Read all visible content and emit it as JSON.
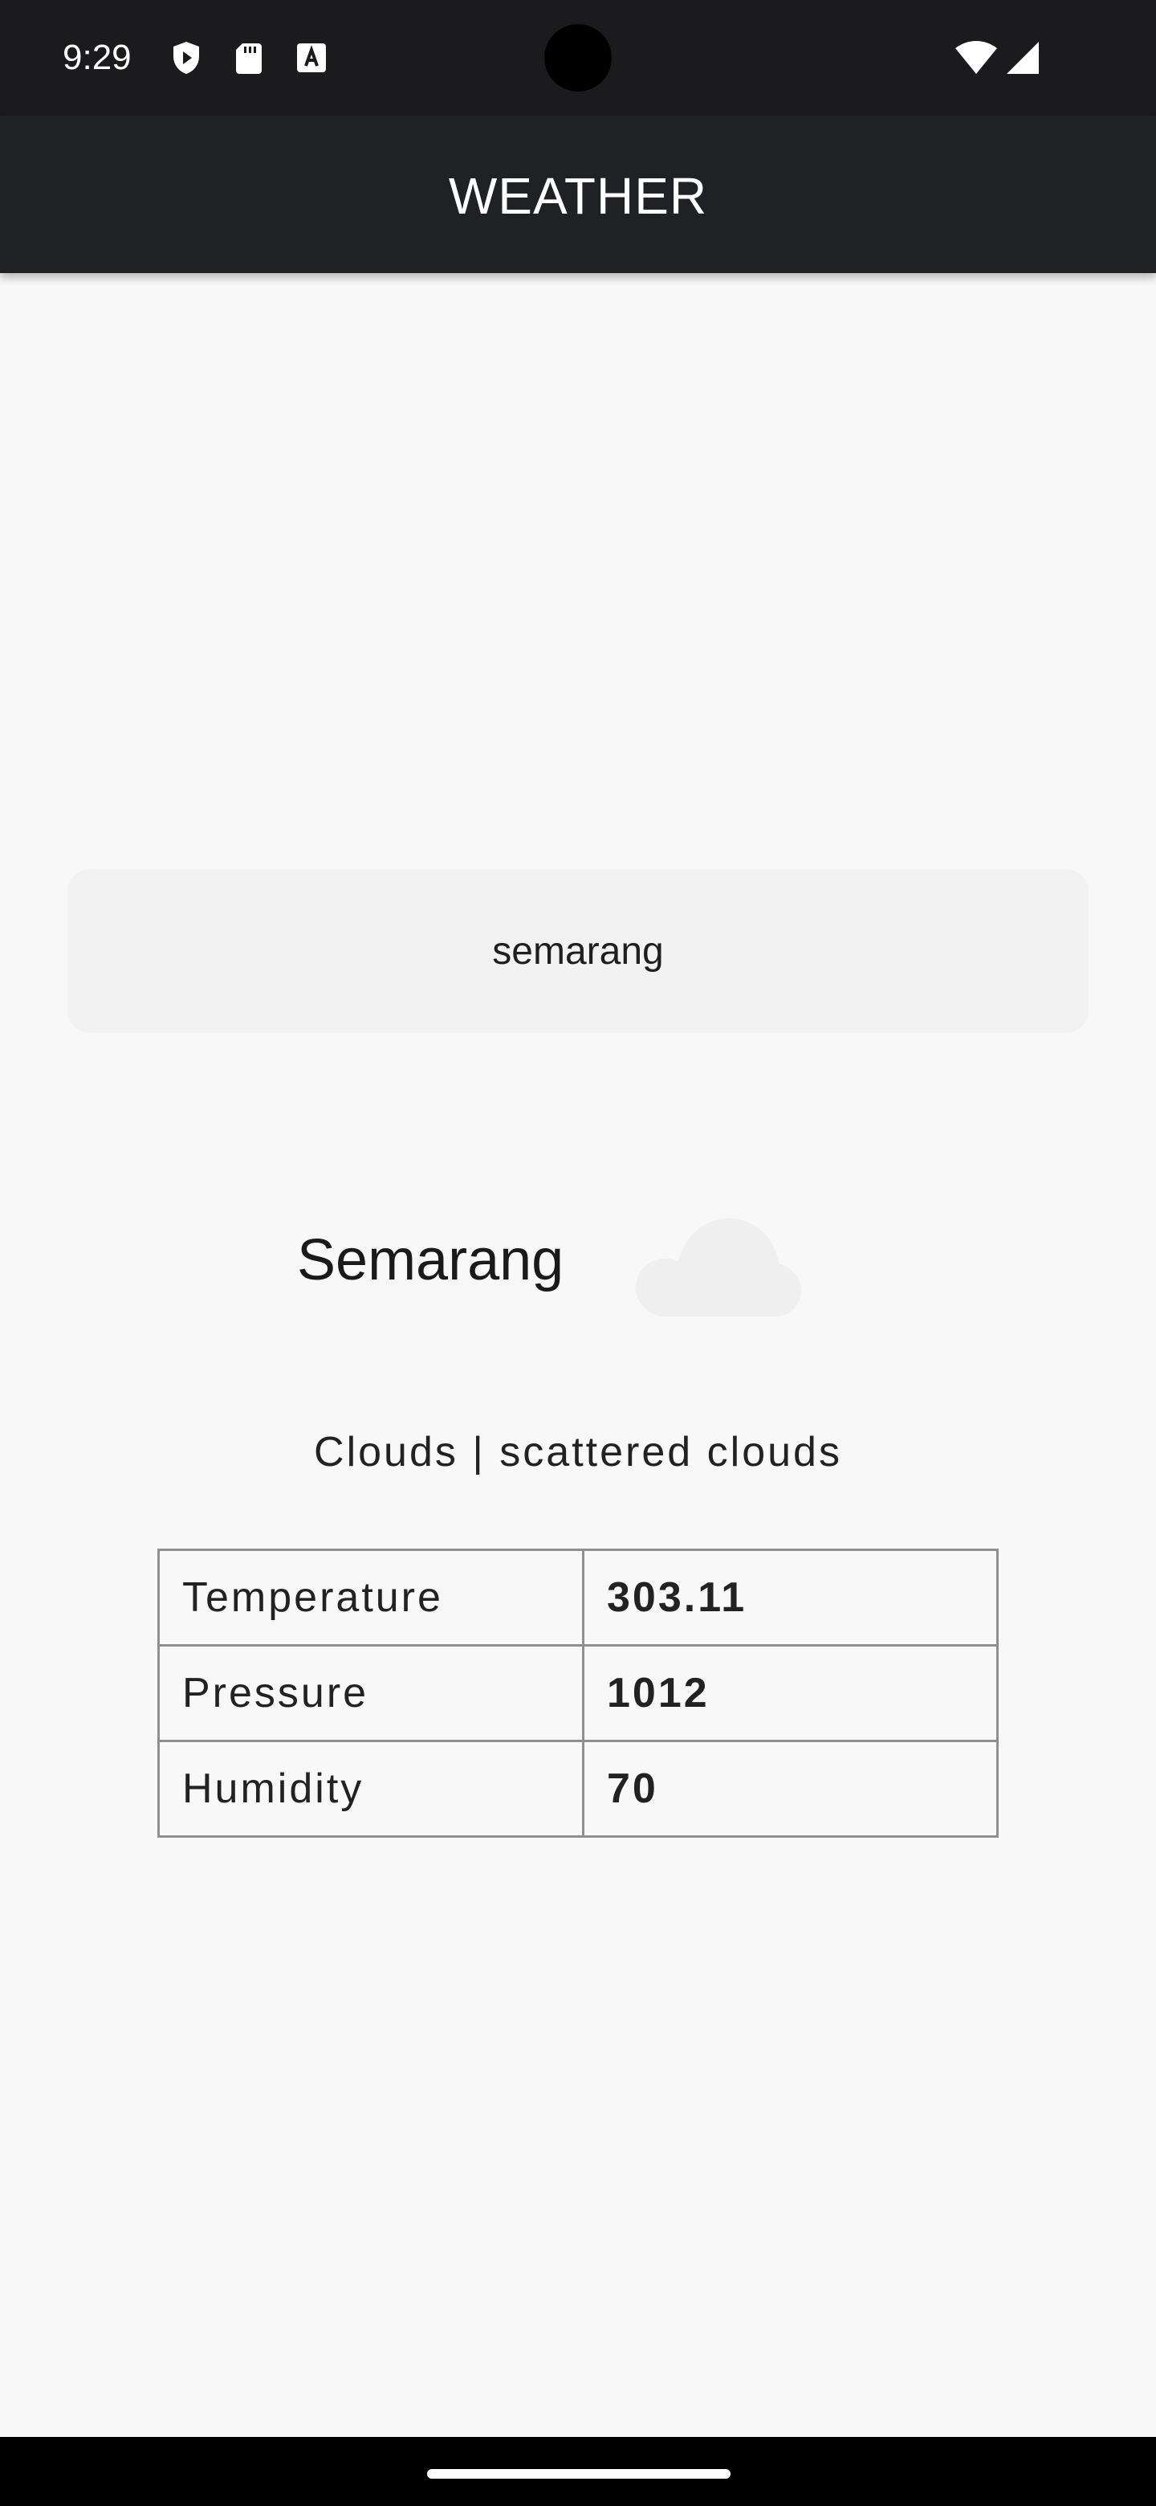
{
  "status_bar": {
    "time": "9:29",
    "left_icons": [
      "shield-play-icon",
      "sd-card-icon",
      "font-a-icon"
    ],
    "right_icons": [
      "wifi-icon",
      "cellular-signal-icon"
    ]
  },
  "app_bar": {
    "title": "WEATHER"
  },
  "search": {
    "value": "semarang"
  },
  "weather": {
    "city": "Semarang",
    "icon": "cloud-icon",
    "description": "Clouds | scattered clouds"
  },
  "details": {
    "rows": [
      {
        "label": "Temperature",
        "value": "303.11"
      },
      {
        "label": "Pressure",
        "value": "1012"
      },
      {
        "label": "Humidity",
        "value": "70"
      }
    ]
  },
  "colors": {
    "app_bar": "#202124",
    "status_bar": "#1b1b1d",
    "background": "#f8f8f8",
    "input_background": "#f2f2f2",
    "cloud": "#f0f0f0"
  }
}
